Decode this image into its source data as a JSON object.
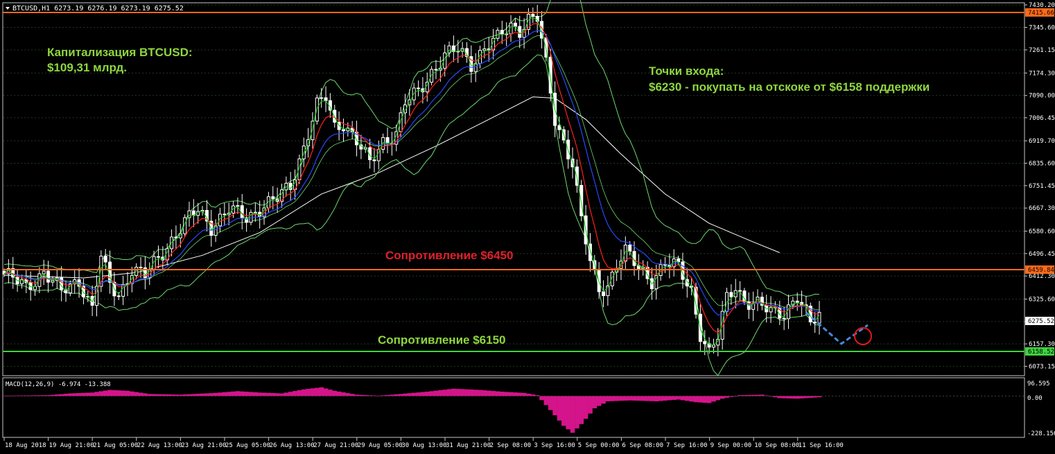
{
  "header": {
    "symbol_line": "BTCUSD,H1  6273.19 6276.19 6273.19 6275.52"
  },
  "annotations": {
    "cap_line1": "Капитализация BTCUSD:",
    "cap_line2": "$109,31 млрд.",
    "entry_line1": "Точки входа:",
    "entry_line2": "$6230 - покупать на отскоке от $6158 поддержки",
    "resistance_upper": "Сопротивление $6450",
    "resistance_lower": "Сопротивление $6150"
  },
  "price_axis": {
    "ticks": [
      "7430.20",
      "7345.60",
      "7261.15",
      "7174.30",
      "7090.00",
      "7006.45",
      "6919.70",
      "6835.60",
      "6751.45",
      "6667.30",
      "6580.60",
      "6496.45",
      "6412.30",
      "6325.60",
      "6241.45",
      "6157.30",
      "6073.15"
    ],
    "tick_values": [
      7430.2,
      7345.6,
      7261.15,
      7174.3,
      7090.0,
      7006.45,
      6919.7,
      6835.6,
      6751.45,
      6667.3,
      6580.6,
      6496.45,
      6412.3,
      6325.6,
      6241.45,
      6157.3,
      6073.15
    ],
    "line_labels": {
      "top_line": "7415.66",
      "mid_line": "6459.84",
      "bottom_line": "6158.52",
      "current_price": "6275.52"
    }
  },
  "macd": {
    "label": "MACD(12,26,9) -6.974 -13.388",
    "ticks": [
      "96.595",
      "0.00",
      "-228.156"
    ]
  },
  "time_axis": {
    "labels": [
      "18 Aug 2018",
      "19 Aug 21:00",
      "21 Aug 05:00",
      "22 Aug 13:00",
      "23 Aug 21:00",
      "25 Aug 05:00",
      "26 Aug 13:00",
      "27 Aug 21:00",
      "29 Aug 05:00",
      "30 Aug 13:00",
      "31 Aug 21:00",
      "2 Sep 08:00",
      "3 Sep 16:00",
      "5 Sep 00:00",
      "6 Sep 08:00",
      "7 Sep 16:00",
      "9 Sep 00:00",
      "10 Sep 08:00",
      "11 Sep 16:00"
    ]
  },
  "colors": {
    "background": "#000000",
    "grid": "#1f3a1f",
    "candle": "#ffffff",
    "bollinger": "#6fd86f",
    "ema_red": "#ff2020",
    "ema_blue": "#2848ff",
    "ema_green": "#00d000",
    "sma_white": "#ffffff",
    "resistance_line": "#ff6a1a",
    "support_line": "#3fd23f",
    "macd_hist": "#d4148a",
    "text_green": "#8fd63f",
    "text_red": "#e0202a",
    "forecast": "#4a86d8",
    "circle": "#e01a1a"
  },
  "chart_data": {
    "type": "candlestick",
    "symbol": "BTCUSD",
    "timeframe": "H1",
    "last_quote": {
      "open": 6273.19,
      "high": 6276.19,
      "low": 6273.19,
      "close": 6275.52
    },
    "ylim": [
      6038,
      7438
    ],
    "horizontal_levels": [
      7415.66,
      6459.84,
      6158.52
    ],
    "price_path": [
      [
        0,
        6420
      ],
      [
        5,
        6370
      ],
      [
        9,
        6430
      ],
      [
        13,
        6350
      ],
      [
        17,
        6400
      ],
      [
        20,
        6290
      ],
      [
        22,
        6480
      ],
      [
        24,
        6380
      ],
      [
        26,
        6340
      ],
      [
        29,
        6440
      ],
      [
        32,
        6410
      ],
      [
        35,
        6480
      ],
      [
        38,
        6550
      ],
      [
        41,
        6610
      ],
      [
        44,
        6660
      ],
      [
        47,
        6600
      ],
      [
        51,
        6660
      ],
      [
        55,
        6630
      ],
      [
        59,
        6680
      ],
      [
        62,
        6700
      ],
      [
        65,
        6750
      ],
      [
        68,
        6900
      ],
      [
        71,
        7050
      ],
      [
        73,
        7080
      ],
      [
        75,
        6970
      ],
      [
        77,
        6990
      ],
      [
        80,
        6920
      ],
      [
        83,
        6830
      ],
      [
        86,
        6920
      ],
      [
        89,
        6950
      ],
      [
        91,
        7060
      ],
      [
        94,
        7100
      ],
      [
        97,
        7180
      ],
      [
        100,
        7240
      ],
      [
        103,
        7260
      ],
      [
        106,
        7210
      ],
      [
        109,
        7270
      ],
      [
        112,
        7300
      ],
      [
        115,
        7350
      ],
      [
        117,
        7340
      ],
      [
        119,
        7380
      ],
      [
        121,
        7380
      ],
      [
        123,
        7200
      ],
      [
        125,
        7000
      ],
      [
        127,
        6920
      ],
      [
        129,
        6840
      ],
      [
        131,
        6620
      ],
      [
        133,
        6460
      ],
      [
        135,
        6360
      ],
      [
        137,
        6380
      ],
      [
        139,
        6460
      ],
      [
        141,
        6500
      ],
      [
        144,
        6440
      ],
      [
        147,
        6400
      ],
      [
        150,
        6460
      ],
      [
        153,
        6440
      ],
      [
        156,
        6360
      ],
      [
        158,
        6200
      ],
      [
        160,
        6120
      ],
      [
        162,
        6180
      ],
      [
        164,
        6330
      ],
      [
        166,
        6380
      ],
      [
        168,
        6320
      ],
      [
        171,
        6300
      ],
      [
        174,
        6280
      ],
      [
        177,
        6280
      ],
      [
        180,
        6330
      ],
      [
        183,
        6230
      ],
      [
        185,
        6275.52
      ]
    ],
    "x_count": 186,
    "series": [
      {
        "name": "Bollinger upper",
        "offset": 90
      },
      {
        "name": "Bollinger lower",
        "offset": -90
      },
      {
        "name": "EMA red",
        "lag": 3
      },
      {
        "name": "EMA blue",
        "lag": 6
      },
      {
        "name": "EMA green",
        "lag": 1
      }
    ],
    "sma200_points": [
      [
        0,
        6415
      ],
      [
        18,
        6405
      ],
      [
        30,
        6425
      ],
      [
        45,
        6490
      ],
      [
        58,
        6575
      ],
      [
        72,
        6720
      ],
      [
        85,
        6800
      ],
      [
        98,
        6900
      ],
      [
        110,
        7000
      ],
      [
        120,
        7085
      ],
      [
        125,
        7080
      ],
      [
        132,
        7000
      ],
      [
        140,
        6870
      ],
      [
        150,
        6720
      ],
      [
        160,
        6610
      ],
      [
        170,
        6540
      ],
      [
        176,
        6500
      ]
    ],
    "forecast_path": [
      [
        182,
        6275
      ],
      [
        190,
        6158
      ],
      [
        196,
        6228
      ]
    ],
    "macd_hist": [
      [
        0,
        2
      ],
      [
        10,
        5
      ],
      [
        15,
        15
      ],
      [
        20,
        20
      ],
      [
        24,
        35
      ],
      [
        28,
        30
      ],
      [
        33,
        12
      ],
      [
        40,
        8
      ],
      [
        48,
        18
      ],
      [
        53,
        28
      ],
      [
        58,
        20
      ],
      [
        63,
        15
      ],
      [
        68,
        38
      ],
      [
        72,
        50
      ],
      [
        75,
        30
      ],
      [
        80,
        8
      ],
      [
        85,
        2
      ],
      [
        90,
        12
      ],
      [
        96,
        25
      ],
      [
        102,
        42
      ],
      [
        108,
        35
      ],
      [
        113,
        25
      ],
      [
        118,
        18
      ],
      [
        121,
        5
      ],
      [
        124,
        -80
      ],
      [
        127,
        -170
      ],
      [
        129,
        -210
      ],
      [
        131,
        -160
      ],
      [
        134,
        -70
      ],
      [
        137,
        -30
      ],
      [
        142,
        -25
      ],
      [
        148,
        -30
      ],
      [
        153,
        -20
      ],
      [
        157,
        -35
      ],
      [
        160,
        -40
      ],
      [
        163,
        -15
      ],
      [
        167,
        5
      ],
      [
        172,
        8
      ],
      [
        176,
        -12
      ],
      [
        180,
        -15
      ],
      [
        185,
        -6.974
      ]
    ],
    "macd_ylim": [
      -228.156,
      96.595
    ]
  }
}
